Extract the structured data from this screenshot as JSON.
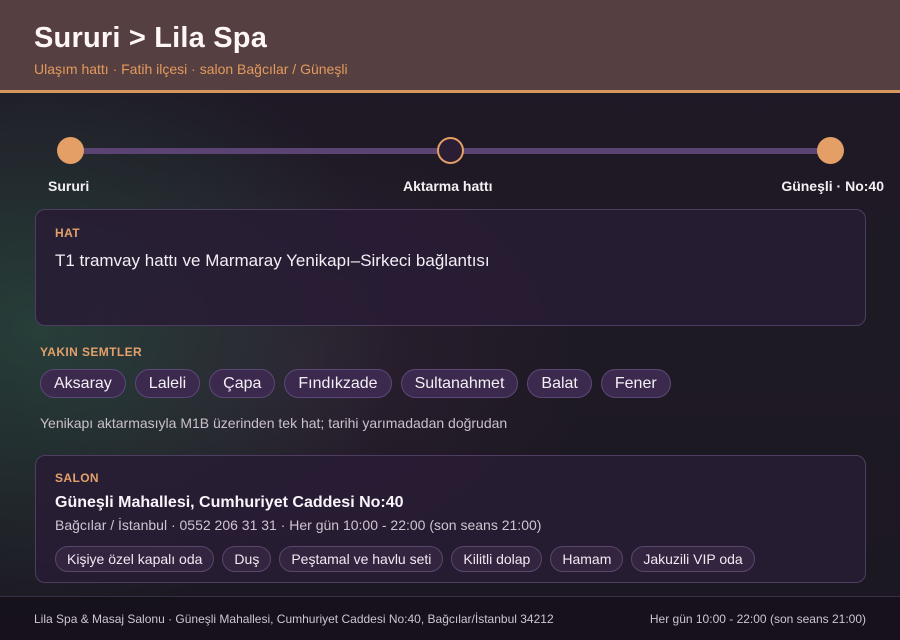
{
  "header": {
    "title": "Sururi > Lila Spa",
    "subtitle": "Ulaşım hattı · Fatih ilçesi · salon Bağcılar / Güneşli"
  },
  "route": {
    "start": "Sururi",
    "middle": "Aktarma hattı",
    "end": "Güneşli · No:40"
  },
  "hat": {
    "kicker": "HAT",
    "text": "T1 tramvay hattı ve Marmaray Yenikapı–Sirkeci bağlantısı"
  },
  "nearby": {
    "title": "YAKIN SEMTLER",
    "items": [
      "Aksaray",
      "Laleli",
      "Çapa",
      "Fındıkzade",
      "Sultanahmet",
      "Balat",
      "Fener"
    ],
    "note": "Yenikapı aktarmasıyla M1B üzerinden tek hat; tarihi yarımadadan doğrudan"
  },
  "salon": {
    "kicker": "SALON",
    "address": "Güneşli Mahallesi, Cumhuriyet Caddesi No:40",
    "meta": "Bağcılar / İstanbul · 0552 206 31 31 · Her gün 10:00 - 22:00 (son seans 21:00)",
    "amenities": [
      "Kişiye özel kapalı oda",
      "Duş",
      "Peştamal ve havlu seti",
      "Kilitli dolap",
      "Hamam",
      "Jakuzili VIP oda"
    ]
  },
  "footer": {
    "left": "Lila Spa & Masaj Salonu · Güneşli Mahallesi, Cumhuriyet Caddesi No:40, Bağcılar/İstanbul 34212",
    "right": "Her gün 10:00 - 22:00 (son seans 21:00)"
  },
  "colors": {
    "accent": "#e39f66",
    "header_bg": "#553f40",
    "route_line": "#5b4474",
    "card_bg": "#281c34"
  }
}
